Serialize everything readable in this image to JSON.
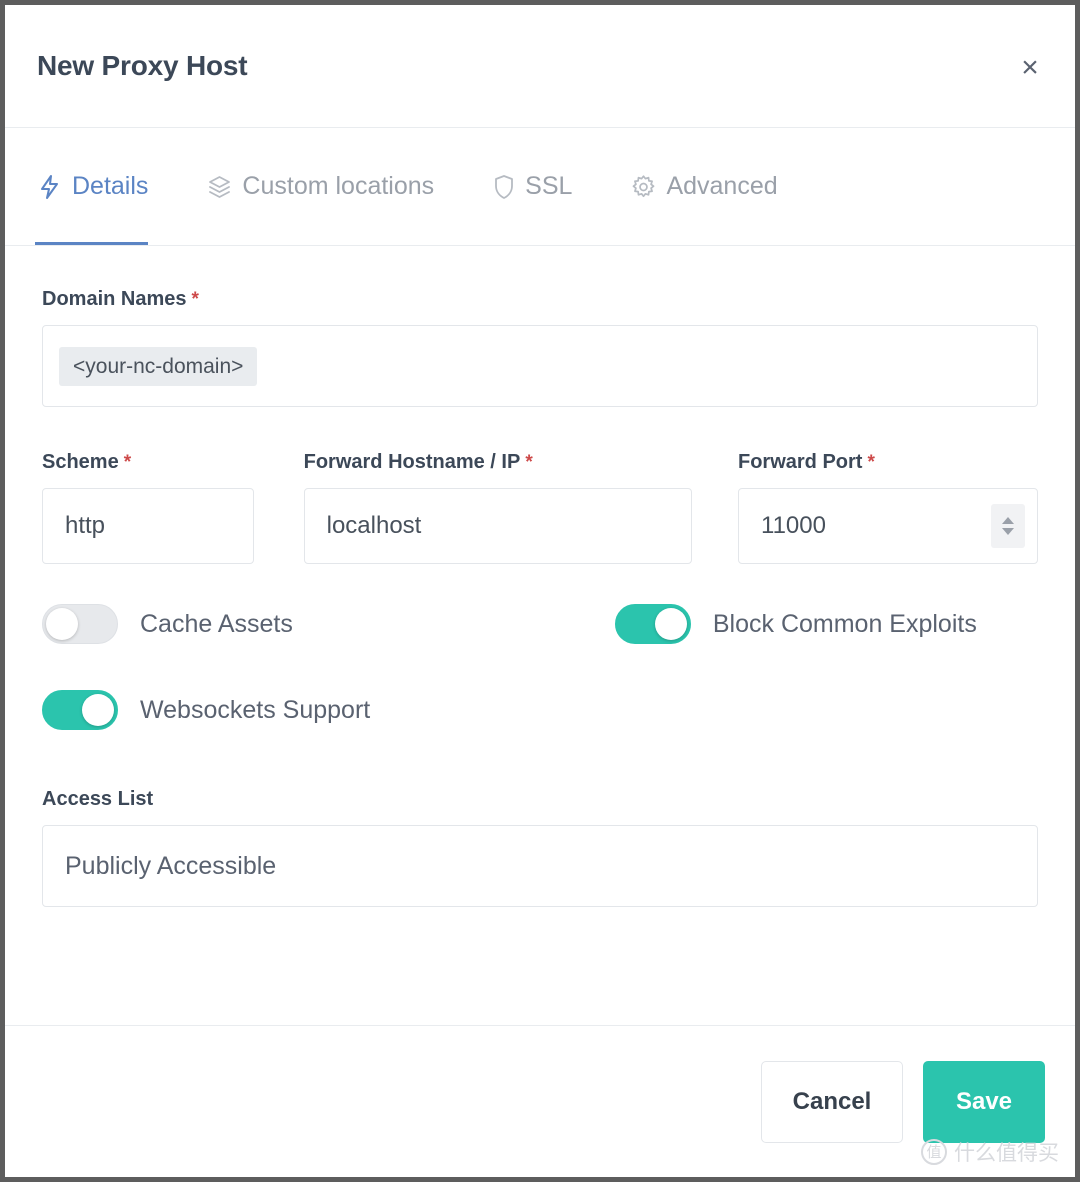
{
  "modal": {
    "title": "New Proxy Host",
    "close_label": "×"
  },
  "tabs": [
    {
      "label": "Details",
      "icon": "bolt-icon",
      "active": true
    },
    {
      "label": "Custom locations",
      "icon": "layers-icon",
      "active": false
    },
    {
      "label": "SSL",
      "icon": "shield-icon",
      "active": false
    },
    {
      "label": "Advanced",
      "icon": "gear-icon",
      "active": false
    }
  ],
  "form": {
    "domain_names": {
      "label": "Domain Names",
      "required_marker": "*",
      "tags": [
        "<your-nc-domain>"
      ],
      "placeholder": ""
    },
    "scheme": {
      "label": "Scheme",
      "required_marker": "*",
      "value": "http"
    },
    "forward_hostname": {
      "label": "Forward Hostname / IP",
      "required_marker": "*",
      "value": "localhost"
    },
    "forward_port": {
      "label": "Forward Port",
      "required_marker": "*",
      "value": "11000"
    },
    "toggles": [
      {
        "label": "Cache Assets",
        "on": false
      },
      {
        "label": "Block Common Exploits",
        "on": true
      },
      {
        "label": "Websockets Support",
        "on": true
      }
    ],
    "access_list": {
      "label": "Access List",
      "value": "Publicly Accessible"
    }
  },
  "footer": {
    "cancel_label": "Cancel",
    "save_label": "Save"
  },
  "watermark": {
    "mark": "值",
    "text": "什么值得买"
  },
  "colors": {
    "accent_teal": "#2bc4ad",
    "tab_active_blue": "#5b84c4",
    "required_red": "#cd4949",
    "text_dark": "#3c4858",
    "text_muted": "#9aa0a9",
    "border": "#e3e6ea"
  }
}
